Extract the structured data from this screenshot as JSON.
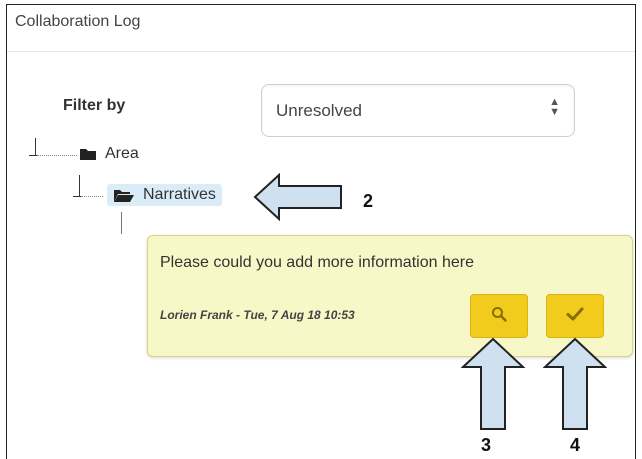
{
  "window": {
    "title": "Collaboration Log"
  },
  "filter": {
    "label": "Filter by",
    "selected": "Unresolved"
  },
  "tree": {
    "root": {
      "label": "Area",
      "icon": "folder-closed-icon"
    },
    "child": {
      "label": "Narratives",
      "icon": "folder-open-icon"
    }
  },
  "comment": {
    "text": "Please could you add more information here",
    "author": "Lorien Frank - Tue, 7 Aug 18 10:53",
    "view_icon": "search-icon",
    "resolve_icon": "checkmark-icon",
    "button_color": "#f2cc1c"
  },
  "annotations": {
    "n2": "2",
    "n3": "3",
    "n4": "4",
    "arrow_fill": "#cfe0f0"
  }
}
